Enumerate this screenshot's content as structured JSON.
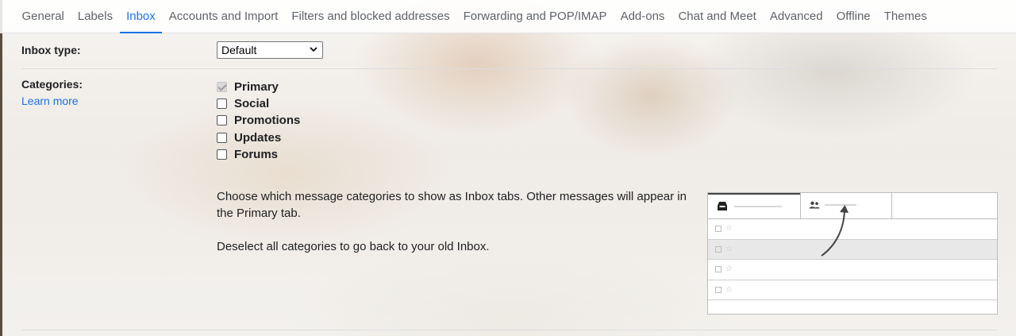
{
  "tabs": [
    {
      "label": "General",
      "active": false
    },
    {
      "label": "Labels",
      "active": false
    },
    {
      "label": "Inbox",
      "active": true
    },
    {
      "label": "Accounts and Import",
      "active": false
    },
    {
      "label": "Filters and blocked addresses",
      "active": false
    },
    {
      "label": "Forwarding and POP/IMAP",
      "active": false
    },
    {
      "label": "Add-ons",
      "active": false
    },
    {
      "label": "Chat and Meet",
      "active": false
    },
    {
      "label": "Advanced",
      "active": false
    },
    {
      "label": "Offline",
      "active": false
    },
    {
      "label": "Themes",
      "active": false
    }
  ],
  "inbox_type": {
    "label": "Inbox type:",
    "selected": "Default"
  },
  "categories": {
    "label": "Categories:",
    "learn_more": "Learn more",
    "items": [
      {
        "label": "Primary",
        "checked": true,
        "disabled": true
      },
      {
        "label": "Social",
        "checked": false,
        "disabled": false
      },
      {
        "label": "Promotions",
        "checked": false,
        "disabled": false
      },
      {
        "label": "Updates",
        "checked": false,
        "disabled": false
      },
      {
        "label": "Forums",
        "checked": false,
        "disabled": false
      }
    ],
    "description_1": "Choose which message categories to show as Inbox tabs. Other messages will appear in the Primary tab.",
    "description_2": "Deselect all categories to go back to your old Inbox."
  },
  "colors": {
    "accent": "#1a73e8",
    "text": "#202124",
    "muted": "#5f6368"
  },
  "icons": [
    "inbox-icon",
    "people-icon",
    "chevron-down-icon",
    "star-icon"
  ]
}
